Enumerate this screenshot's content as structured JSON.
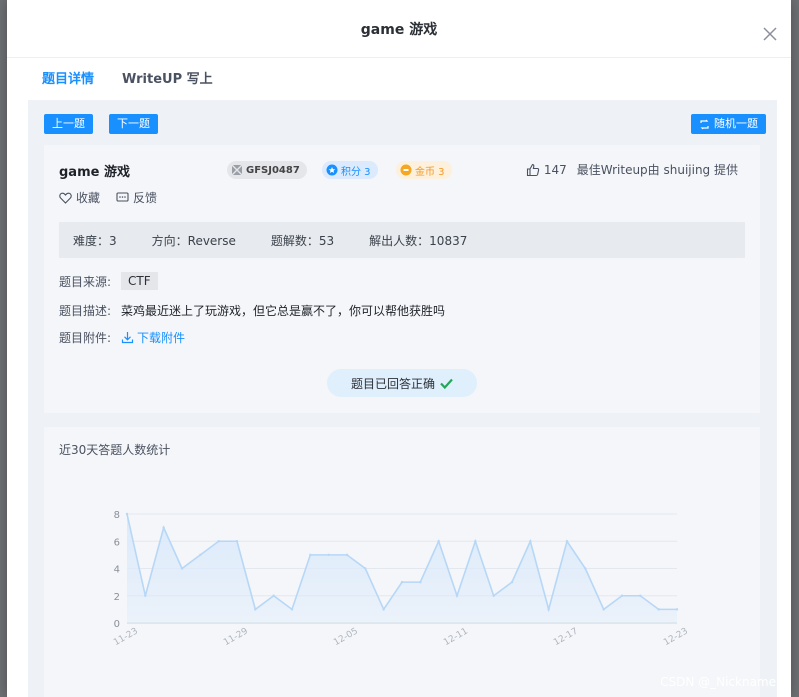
{
  "modal": {
    "title": "game 游戏"
  },
  "tabs": [
    {
      "label": "题目详情",
      "active": true
    },
    {
      "label": "WriteUP 写上",
      "active": false
    }
  ],
  "nav": {
    "prev": "上一题",
    "next": "下一题",
    "random": "随机一题"
  },
  "question": {
    "name": "game 游戏",
    "code": "GFSJ0487",
    "score": "积分 3",
    "coin": "金币 3",
    "likes": "147",
    "writeup_by": "最佳Writeup由 shuijing 提供",
    "favorite": "收藏",
    "feedback": "反馈",
    "difficulty": "难度：3",
    "direction": "方向：Reverse",
    "writeup_count": "题解数：53",
    "solvers": "解出人数：10837",
    "source_label": "题目来源:",
    "source_value": "CTF",
    "desc_label": "题目描述:",
    "desc_value": "菜鸡最近迷上了玩游戏，但它总是赢不了，你可以帮他获胜吗",
    "attach_label": "题目附件:",
    "attach_value": "下载附件",
    "answered": "题目已回答正确"
  },
  "chart_title": "近30天答题人数统计",
  "chart_data": {
    "type": "area",
    "x": [
      "11-23",
      "11-24",
      "11-25",
      "11-26",
      "11-27",
      "11-28",
      "11-29",
      "11-30",
      "12-01",
      "12-02",
      "12-03",
      "12-04",
      "12-05",
      "12-06",
      "12-07",
      "12-08",
      "12-09",
      "12-10",
      "12-11",
      "12-12",
      "12-13",
      "12-14",
      "12-15",
      "12-16",
      "12-17",
      "12-18",
      "12-19",
      "12-20",
      "12-21",
      "12-22",
      "12-23"
    ],
    "values": [
      8,
      2,
      7,
      4,
      5,
      6,
      6,
      1,
      2,
      1,
      5,
      5,
      5,
      4,
      1,
      3,
      3,
      6,
      2,
      6,
      2,
      3,
      6,
      1,
      6,
      4,
      1,
      2,
      2,
      1,
      1
    ],
    "x_tick_labels": [
      "11-23",
      "11-29",
      "12-05",
      "12-11",
      "12-17",
      "12-23"
    ],
    "y_ticks": [
      0,
      2,
      4,
      6,
      8
    ],
    "ylim": [
      0,
      8
    ],
    "grid": true,
    "line_color": "#b7d7f7",
    "fill_color": "#dbeafb"
  },
  "watermark": "CSDN @_Nickname",
  "colors": {
    "accent": "#1890ff",
    "coin": "#f59a23",
    "success": "#26a65b"
  }
}
